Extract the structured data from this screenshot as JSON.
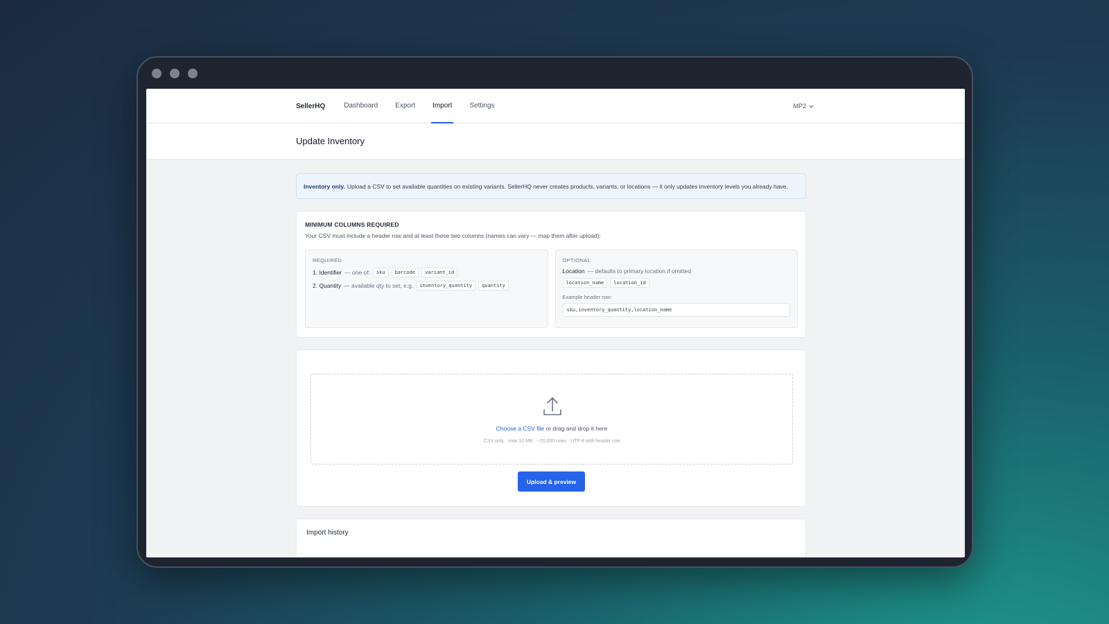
{
  "nav": {
    "brand": "SellerHQ",
    "links": [
      "Dashboard",
      "Export",
      "Import",
      "Settings"
    ],
    "active": "Import",
    "store": "MP2"
  },
  "page": {
    "title": "Update Inventory"
  },
  "notice": {
    "bold": "Inventory only.",
    "text": "Upload a CSV to set available quantities on existing variants. SellerHQ never creates products, variants, or locations — it only updates inventory levels you already have."
  },
  "requirements": {
    "title": "MINIMUM COLUMNS REQUIRED",
    "description": "Your CSV must include a header row and at least these two columns (names can vary — map them after upload):",
    "required": {
      "title": "REQUIRED",
      "identifier_label": "1. Identifier",
      "identifier_note": "— one of:",
      "identifier_codes": [
        "sku",
        "barcode",
        "variant_id"
      ],
      "quantity_label": "2. Quantity",
      "quantity_note": "— available qty to set, e.g.",
      "quantity_codes": [
        "inventory_quantity",
        "quantity"
      ]
    },
    "optional": {
      "title": "OPTIONAL",
      "location_label": "Location",
      "location_note": "— defaults to primary location if omitted",
      "location_codes": [
        "location_name",
        "location_id"
      ],
      "example_label": "Example header row:",
      "example_value": "sku,inventory_quantity,location_name"
    }
  },
  "upload": {
    "link_text": "Choose a CSV file",
    "text": "or drag and drop it here",
    "hint": "CSV only · max 10 MB · ~20,000 rows · UTF-8 with header row",
    "button": "Upload & preview"
  },
  "history": {
    "title": "Import history"
  }
}
